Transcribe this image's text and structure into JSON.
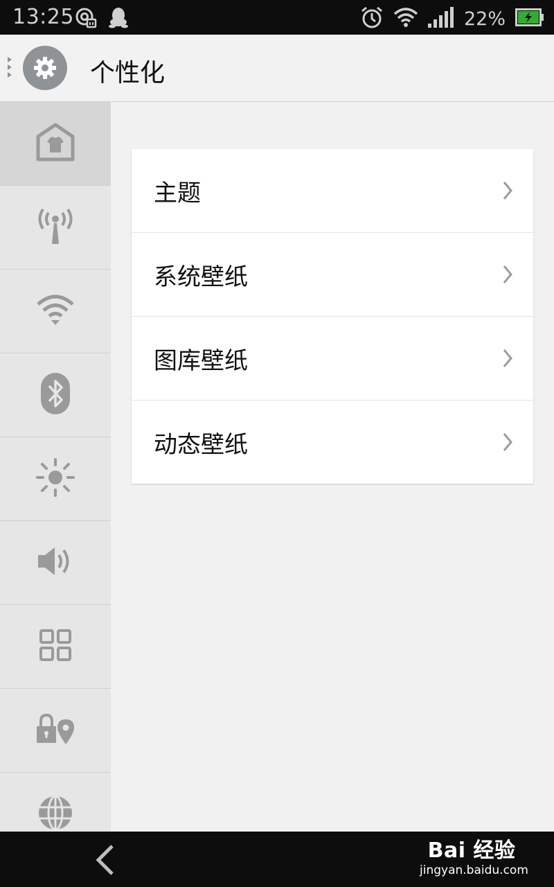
{
  "status_bar": {
    "time": "13:25",
    "battery": "22%",
    "icons": [
      "data-saver-icon",
      "qq-icon",
      "alarm-icon",
      "wifi-icon",
      "signal-icon",
      "battery-charging-icon"
    ]
  },
  "header": {
    "title": "个性化",
    "icon": "gear-icon"
  },
  "sidebar": {
    "items": [
      {
        "icon": "theme-house-icon",
        "selected": true
      },
      {
        "icon": "hotspot-antenna-icon",
        "selected": false
      },
      {
        "icon": "wifi-icon",
        "selected": false
      },
      {
        "icon": "bluetooth-icon",
        "selected": false
      },
      {
        "icon": "brightness-icon",
        "selected": false
      },
      {
        "icon": "volume-icon",
        "selected": false
      },
      {
        "icon": "apps-grid-icon",
        "selected": false
      },
      {
        "icon": "lock-location-icon",
        "selected": false
      },
      {
        "icon": "globe-icon",
        "selected": false
      }
    ]
  },
  "menu": {
    "items": [
      {
        "label": "主题"
      },
      {
        "label": "系统壁纸"
      },
      {
        "label": "图库壁纸"
      },
      {
        "label": "动态壁纸"
      }
    ]
  },
  "nav_bar": {
    "back_icon": "back-arrow-icon"
  },
  "watermark": {
    "brand": "Bai  经验",
    "url": "jingyan.baidu.com"
  },
  "colors": {
    "status_bar_bg": "#0d0d0d",
    "header_bg": "#f2f2f2",
    "sidebar_bg": "#e6e6e6",
    "sidebar_selected_bg": "#d6d6d6",
    "icon_gray": "#9a9a9a",
    "battery_green": "#2fae2f"
  }
}
